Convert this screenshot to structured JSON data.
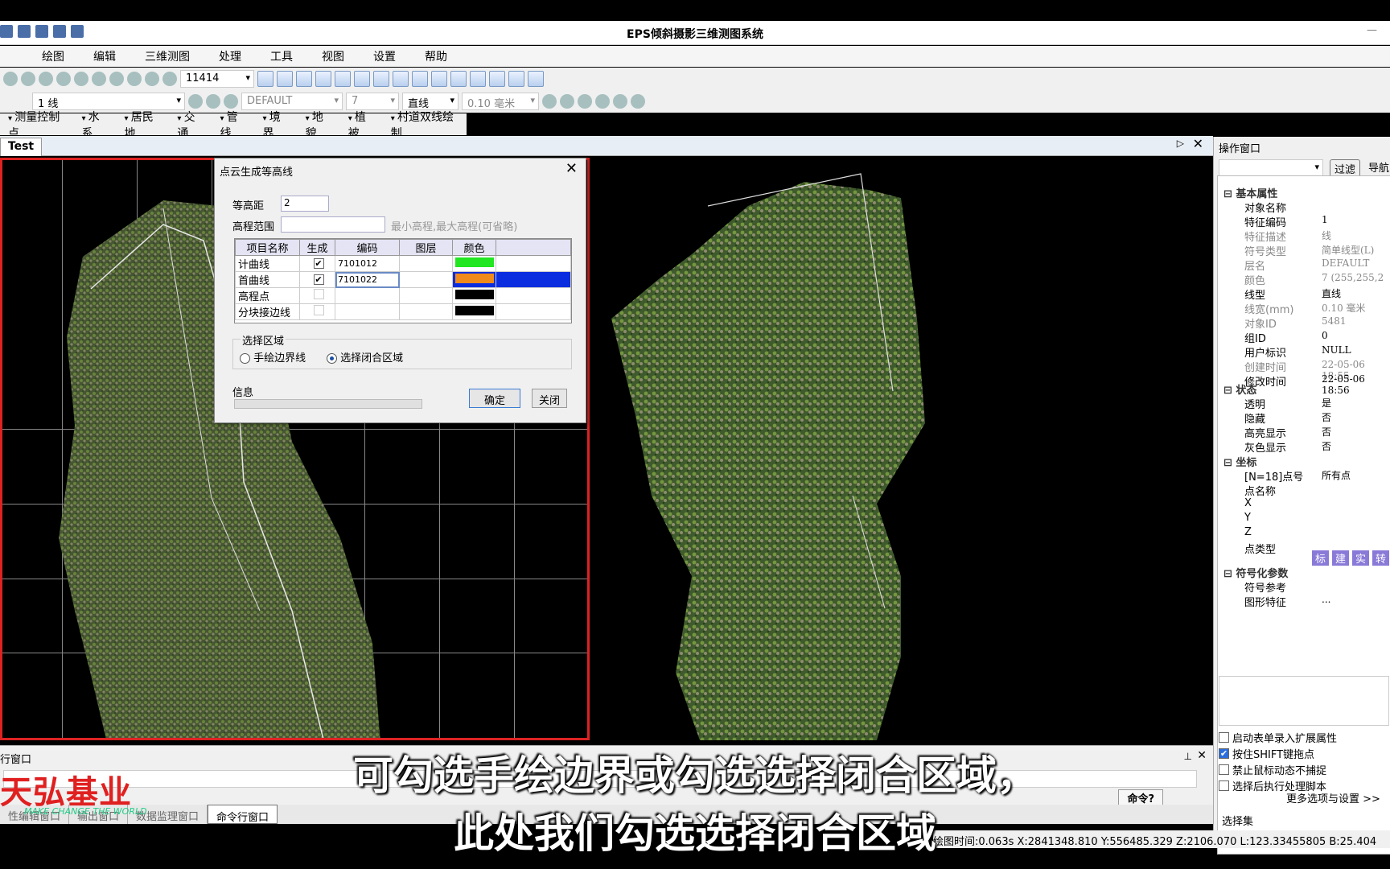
{
  "app": {
    "title": "EPS倾斜摄影三维测图系统"
  },
  "menu": [
    "绘图",
    "编辑",
    "三维测图",
    "处理",
    "工具",
    "视图",
    "设置",
    "帮助"
  ],
  "toolbar": {
    "code_value": "11414",
    "layer_type": "1 线",
    "layer_name": "DEFAULT",
    "color_value": "7",
    "line_type": "直线",
    "line_width": "0.10 毫米"
  },
  "feature_menu": [
    "测量控制点",
    "水系",
    "居民地",
    "交通",
    "管线",
    "境界",
    "地貌",
    "植被",
    "村道双线绘制"
  ],
  "tab": {
    "label": "Test"
  },
  "dialog": {
    "title": "点云生成等高线",
    "interval_label": "等高距",
    "interval_value": "2",
    "range_label": "高程范围",
    "range_hint": "最小高程,最大高程(可省略)",
    "columns": [
      "项目名称",
      "生成",
      "编码",
      "图层",
      "颜色"
    ],
    "rows": [
      {
        "name": "计曲线",
        "checked": "✔",
        "code": "7101012",
        "layer": "",
        "color": "#22e622"
      },
      {
        "name": "首曲线",
        "checked": "✔",
        "code": "7101022",
        "layer": "",
        "color": "#f08a1a"
      },
      {
        "name": "高程点",
        "checked": "",
        "code": "",
        "layer": "",
        "color": "#000000"
      },
      {
        "name": "分块接边线",
        "checked": "",
        "code": "",
        "layer": "",
        "color": "#000000"
      }
    ],
    "region_label": "选择区域",
    "option_manual": "手绘边界线",
    "option_closed": "选择闭合区域",
    "info_label": "信息",
    "ok_label": "确定",
    "close_label": "关闭"
  },
  "right_panel": {
    "title": "操作窗口",
    "filter_label": "过滤",
    "nav_label": "导航",
    "sections": {
      "basic": "基本属性",
      "state": "状态",
      "coords": "坐标",
      "symbol": "符号化参数"
    },
    "props": [
      {
        "k": "对象名称",
        "v": ""
      },
      {
        "k": "特征编码",
        "v": "1"
      },
      {
        "k": "特征描述",
        "v": "线",
        "grey": true
      },
      {
        "k": "符号类型",
        "v": "简单线型(L)",
        "grey": true
      },
      {
        "k": "层名",
        "v": "DEFAULT",
        "grey": true
      },
      {
        "k": "颜色",
        "v": "7 (255,255,2",
        "grey": true
      },
      {
        "k": "线型",
        "v": "直线"
      },
      {
        "k": "线宽(mm)",
        "v": "0.10 毫米",
        "grey": true
      },
      {
        "k": "对象ID",
        "v": "5481",
        "grey": true
      },
      {
        "k": "组ID",
        "v": "0"
      },
      {
        "k": "用户标识",
        "v": "NULL"
      },
      {
        "k": "创建时间",
        "v": "22-05-06 18:55",
        "grey": true
      },
      {
        "k": "修改时间",
        "v": "22-05-06 18:56"
      }
    ],
    "state_props": [
      {
        "k": "透明",
        "v": "是"
      },
      {
        "k": "隐藏",
        "v": "否"
      },
      {
        "k": "高亮显示",
        "v": "否"
      },
      {
        "k": "灰色显示",
        "v": "否"
      }
    ],
    "coord_props": [
      {
        "k": "[N=18]点号",
        "v": "所有点"
      },
      {
        "k": "点名称",
        "v": ""
      },
      {
        "k": "X",
        "v": ""
      },
      {
        "k": "Y",
        "v": ""
      },
      {
        "k": "Z",
        "v": ""
      },
      {
        "k": "点类型",
        "v": ""
      }
    ],
    "point_types": [
      "标",
      "建",
      "实",
      "转"
    ],
    "symbol_props": [
      {
        "k": "符号参考",
        "v": ""
      },
      {
        "k": "图形特征",
        "v": "..."
      }
    ],
    "options": [
      {
        "label": "启动表单录入扩展属性",
        "checked": false
      },
      {
        "label": "按住SHIFT键拖点",
        "checked": true
      },
      {
        "label": "禁止鼠标动态不捕捉",
        "checked": false
      },
      {
        "label": "选择后执行处理脚本",
        "checked": false
      }
    ],
    "more_label": "更多选项与设置 >>",
    "select_set_label": "选择集"
  },
  "command": {
    "window_label": "行窗口",
    "prompt_label": "命令?",
    "tabs": [
      "性编辑窗口",
      "输出窗口",
      "数据监理窗口",
      "命令行窗口"
    ]
  },
  "status": {
    "text": "绘图时间:0.063s   X:2841348.810 Y:556485.329 Z:2106.070 L:123.33455805 B:25.404"
  },
  "subtitles": [
    "可勾选手绘边界或勾选选择闭合区域，",
    "此处我们勾选选择闭合区域"
  ],
  "logo": {
    "text": "天弘基业",
    "tagline": "MAKE CHANGE THE WORLD"
  }
}
